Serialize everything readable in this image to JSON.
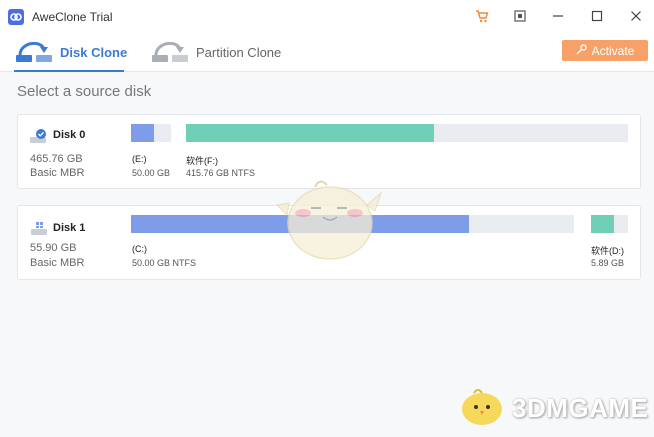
{
  "window": {
    "title": "AweClone Trial",
    "controls": [
      "cart-icon",
      "restore-icon",
      "minimize-icon",
      "maximize-icon",
      "close-icon"
    ]
  },
  "tabs": [
    {
      "label": "Disk Clone",
      "icon": "disk-clone-icon",
      "active": true
    },
    {
      "label": "Partition Clone",
      "icon": "partition-clone-icon",
      "active": false
    }
  ],
  "activate": {
    "label": "Activate",
    "icon": "key-icon"
  },
  "heading": "Select a source disk",
  "disks": [
    {
      "name": "Disk 0",
      "size": "465.76 GB",
      "type": "Basic MBR",
      "selected": true,
      "partitions": [
        {
          "label": "(E:)",
          "detail": "50.00 GB",
          "fill_fraction": 0.75,
          "color": "#7f9ce8"
        },
        {
          "label": "软件(F:)",
          "detail": "415.76 GB NTFS",
          "fill_fraction": 0.56,
          "color": "#6fcfb6"
        }
      ]
    },
    {
      "name": "Disk 1",
      "size": "55.90 GB",
      "type": "Basic MBR",
      "selected": false,
      "partitions": [
        {
          "label": "(C:)",
          "detail": "50.00 GB NTFS",
          "fill_fraction": 0.8,
          "color": "#7f9ce8"
        },
        {
          "label": "软件(D:)",
          "detail": "5.89 GB",
          "fill_fraction": 0.6,
          "color": "#6fcfb6"
        }
      ]
    }
  ],
  "colors": {
    "accent": "#3a7bd5",
    "activate": "#f7a169",
    "bar_empty": "#e8ebf0"
  },
  "watermark": {
    "text": "3DMGAME"
  }
}
